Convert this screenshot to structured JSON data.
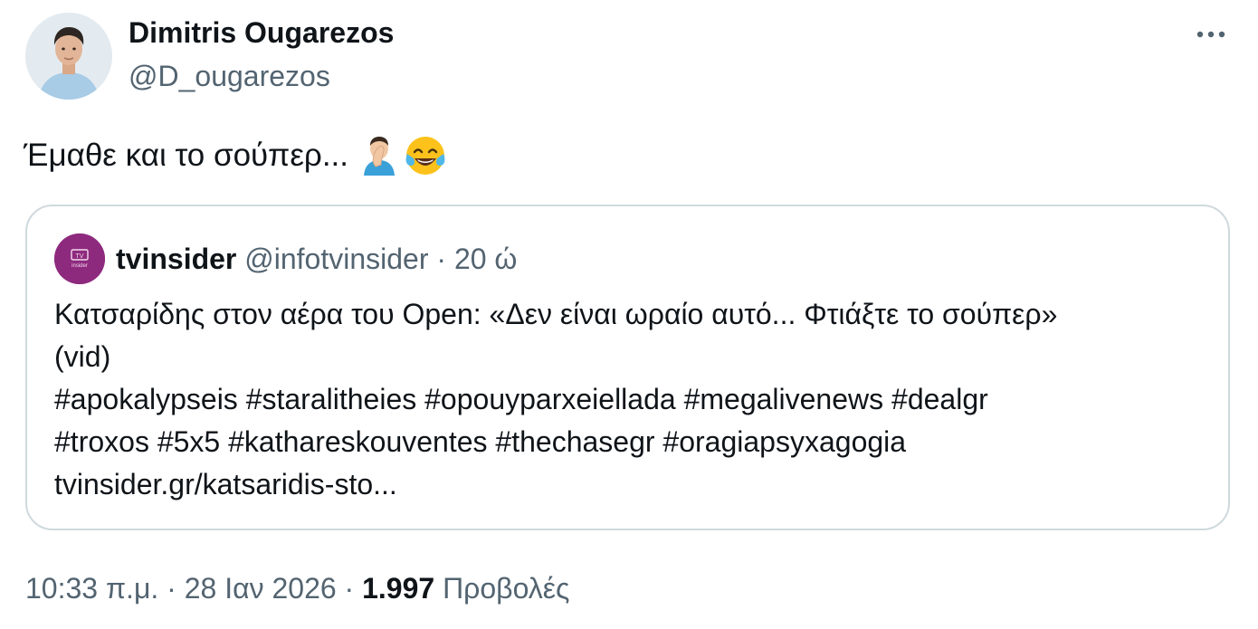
{
  "author": {
    "name": "Dimitris Ougarezos",
    "handle": "@D_ougarezos",
    "avatar_icon": "profile-photo"
  },
  "more_icon": "more-horizontal-icon",
  "tweet": {
    "text": "Έμαθε και το σούπερ...",
    "emojis": [
      "man-facepalming-emoji",
      "face-with-tears-of-joy-emoji"
    ]
  },
  "quote": {
    "name": "tvinsider",
    "handle": "@infotvinsider",
    "separator": "·",
    "time": "20 ώ",
    "avatar_text": "TV insider",
    "avatar_color": "#8e2a7e",
    "lines": [
      "Κατσαρίδης στον αέρα του Open: «Δεν είναι ωραίο αυτό... Φτιάξτε το σούπερ»",
      "(vid)",
      "#apokalypseis #staralitheies #opouyparxeiellada #megalivenews #dealgr",
      "#troxos #5x5 #kathareskouventes #thechasegr #oragiapsyxagogia",
      "tvinsider.gr/katsaridis-sto..."
    ]
  },
  "footer": {
    "time": "10:33 π.μ.",
    "separator1": "·",
    "date": "28 Ιαν 2026",
    "separator2": "·",
    "views_count": "1.997",
    "views_label": "Προβολές"
  },
  "colors": {
    "text": "#0f1419",
    "secondary": "#536471",
    "border": "#cfd9de"
  }
}
